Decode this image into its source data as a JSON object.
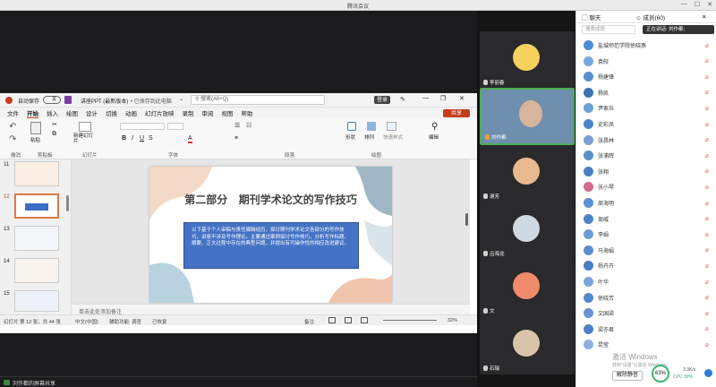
{
  "window": {
    "title": "腾讯会议"
  },
  "ppt": {
    "autosave_label": "自动保存",
    "autosave_state": "关",
    "doc_title": "讲座PPT (最新版本)",
    "saved_status": "• 已保存到此电脑",
    "search_placeholder": "搜索(Alt+Q)",
    "login_label": "登录",
    "share_label": "共享",
    "menu": [
      "文件",
      "开始",
      "插入",
      "绘图",
      "设计",
      "切换",
      "动画",
      "幻灯片放映",
      "录制",
      "审阅",
      "视图",
      "帮助"
    ],
    "active_menu": "开始",
    "ribbon_groups": [
      "撤消",
      "剪贴板",
      "幻灯片",
      "字体",
      "段落",
      "绘图"
    ],
    "ribbon_buttons": {
      "paste": "粘贴",
      "new_slide": "新建幻灯片",
      "shape": "形状",
      "arrange": "排列",
      "quick_style": "快速样式",
      "edit": "编辑"
    },
    "thumb_numbers": [
      "11",
      "12",
      "13",
      "14",
      "15"
    ],
    "slide": {
      "title": "第二部分   期刊学术论文的写作技巧",
      "body": "以下基于个人审稿与责任编辑经历，探讨期刊学术论文各部分的写作技巧，讲座不涉及写作理论，主要通过案例探讨写作技巧，分析写作标题、摘要、正文过程中存在的典型问题，并提出有可操作性的相应改进建议。"
    },
    "notes_placeholder": "单击此处添加备注",
    "status": {
      "slide_info": "幻灯片 第 12 张，共 44 张",
      "lang": "中文(中国)",
      "accessibility": "辅助功能: 调查",
      "recover": "已恢复",
      "notes": "备注",
      "zoom": "32%"
    }
  },
  "bottom": {
    "share_screen_label": "刘作都的屏幕共享"
  },
  "videos": [
    {
      "name": "李丽春",
      "avatar_color": "#f7d15d"
    },
    {
      "name": "刘作都",
      "avatar_color": "#8aa7c2"
    },
    {
      "name": "谢芳",
      "avatar_color": "#e9b98f"
    },
    {
      "name": "吕海龙",
      "avatar_color": "#cfd9e4"
    },
    {
      "name": "文",
      "avatar_color": "#f08a6a"
    },
    {
      "name": "石瑞",
      "avatar_color": "#d9c4a8"
    }
  ],
  "panel": {
    "tab_chat": "聊天",
    "tab_members": "成员(60)",
    "search_placeholder": "搜索成员",
    "speaking_label": "正在讲话: 刘作都;",
    "members": [
      {
        "name": "盐城师范学院徐晓燕",
        "color": "#4c8bd6"
      },
      {
        "name": "袁皎",
        "color": "#7aa7e0"
      },
      {
        "name": "杨建锋",
        "color": "#5a8fd0"
      },
      {
        "name": "杨凯",
        "color": "#3d6fb0"
      },
      {
        "name": "尹家兵",
        "color": "#6ea0d8"
      },
      {
        "name": "史彩凤",
        "color": "#4e86cc"
      },
      {
        "name": "张昌林",
        "color": "#7d9fd3"
      },
      {
        "name": "张浦辉",
        "color": "#5f8dc9"
      },
      {
        "name": "张翔",
        "color": "#4a7fc4"
      },
      {
        "name": "张小琴",
        "color": "#d16b8f"
      },
      {
        "name": "周海明",
        "color": "#5d8fd6"
      },
      {
        "name": "周威",
        "color": "#4f83c8"
      },
      {
        "name": "李娟",
        "color": "#6c9bd6"
      },
      {
        "name": "马海娟",
        "color": "#5b8ed1"
      },
      {
        "name": "杨卉卉",
        "color": "#4a7cc3"
      },
      {
        "name": "叶华",
        "color": "#7aa4da"
      },
      {
        "name": "徐晓芳",
        "color": "#5486cc"
      },
      {
        "name": "文国梁",
        "color": "#6893d2"
      },
      {
        "name": "梁亦君",
        "color": "#4e80c6"
      },
      {
        "name": "昆莹",
        "color": "#8fb0de"
      }
    ],
    "watermark1": "激活 Windows",
    "watermark2": "转到\"设置\"以激活 Windows。",
    "mute_all_label": "解除静音",
    "net_percent": "63%",
    "net_up": "3.3K/s",
    "cpu": "CPU 39%"
  }
}
